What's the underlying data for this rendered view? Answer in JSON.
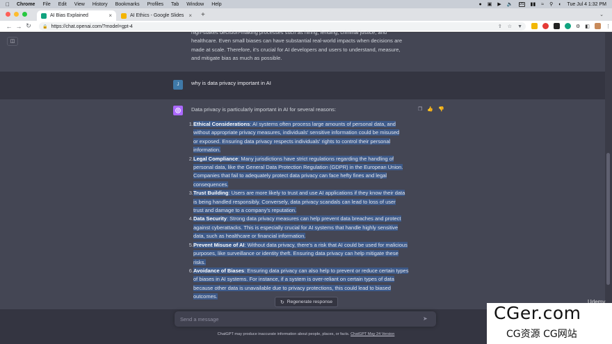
{
  "menubar": {
    "app": "Chrome",
    "items": [
      "File",
      "Edit",
      "View",
      "History",
      "Bookmarks",
      "Profiles",
      "Tab",
      "Window",
      "Help"
    ],
    "input_source": "US",
    "datetime": "Tue Jul 4  1:32 PM"
  },
  "tabs": [
    {
      "title": "AI Bias Explained",
      "favicon_color": "#10a37f"
    },
    {
      "title": "AI Ethics - Google Slides",
      "favicon_color": "#f4b400"
    }
  ],
  "address": {
    "url": "https://chat.openai.com/?model=gpt-4"
  },
  "chat": {
    "prev_answer_lines": [
      "high-stakes decision-making processes such as hiring, lending, criminal justice, and",
      "healthcare. Even small biases can have substantial real-world impacts when decisions are",
      "made at scale. Therefore, it's crucial for AI developers and users to understand, measure,",
      "and mitigate bias as much as possible."
    ],
    "user_initial": "J",
    "user_message": "why is data privacy important in AI",
    "intro": "Data privacy is particularly important in AI for several reasons:",
    "points": [
      {
        "num": "1.",
        "title": "Ethical Considerations",
        "lines": [
          "Ethical Considerations: AI systems often process large amounts of personal data, and",
          "without appropriate privacy measures, individuals' sensitive information could be misused",
          "or exposed. Ensuring data privacy respects individuals' rights to control their personal",
          "information."
        ]
      },
      {
        "num": "2.",
        "title": "Legal Compliance",
        "lines": [
          "Legal Compliance: Many jurisdictions have strict regulations regarding the handling of",
          "personal data, like the General Data Protection Regulation (GDPR) in the European Union.",
          "Companies that fail to adequately protect data privacy can face hefty fines and legal",
          "consequences."
        ]
      },
      {
        "num": "3.",
        "title": "Trust Building",
        "lines": [
          "Trust Building: Users are more likely to trust and use AI applications if they know their data",
          "is being handled responsibly. Conversely, data privacy scandals can lead to loss of user",
          "trust and damage to a company's reputation."
        ]
      },
      {
        "num": "4.",
        "title": "Data Security",
        "lines": [
          "Data Security: Strong data privacy measures can help prevent data breaches and protect",
          "against cyberattacks. This is especially crucial for AI systems that handle highly sensitive",
          "data, such as healthcare or financial information."
        ]
      },
      {
        "num": "5.",
        "title": "Prevent Misuse of AI",
        "lines": [
          "Prevent Misuse of AI: Without data privacy, there's a risk that AI could be used for malicious",
          "purposes, like surveillance or identity theft. Ensuring data privacy can help mitigate these",
          "risks."
        ]
      },
      {
        "num": "6.",
        "title": "Avoidance of Biases",
        "lines": [
          "Avoidance of Biases: Ensuring data privacy can also help to prevent or reduce certain types",
          "of biases in AI systems. For instance, if a system is over-reliant on certain types of data",
          "because other data is unavailable due to privacy protections, this could lead to biased",
          "outcomes."
        ]
      }
    ],
    "regenerate_label": "Regenerate response",
    "input_placeholder": "Send a message",
    "disclaimer": "ChatGPT may produce inaccurate information about people, places, or facts.",
    "disclaimer_link": "ChatGPT May 24 Version"
  },
  "overlay": {
    "udemy": "Udemy",
    "watermark_line1": "CGer.com",
    "watermark_line2": "CG资源 CG网站"
  },
  "colors": {
    "gpt_avatar": "#ab68ff",
    "user_avatar": "#3f79a8",
    "selection": "#3d5a8a"
  }
}
